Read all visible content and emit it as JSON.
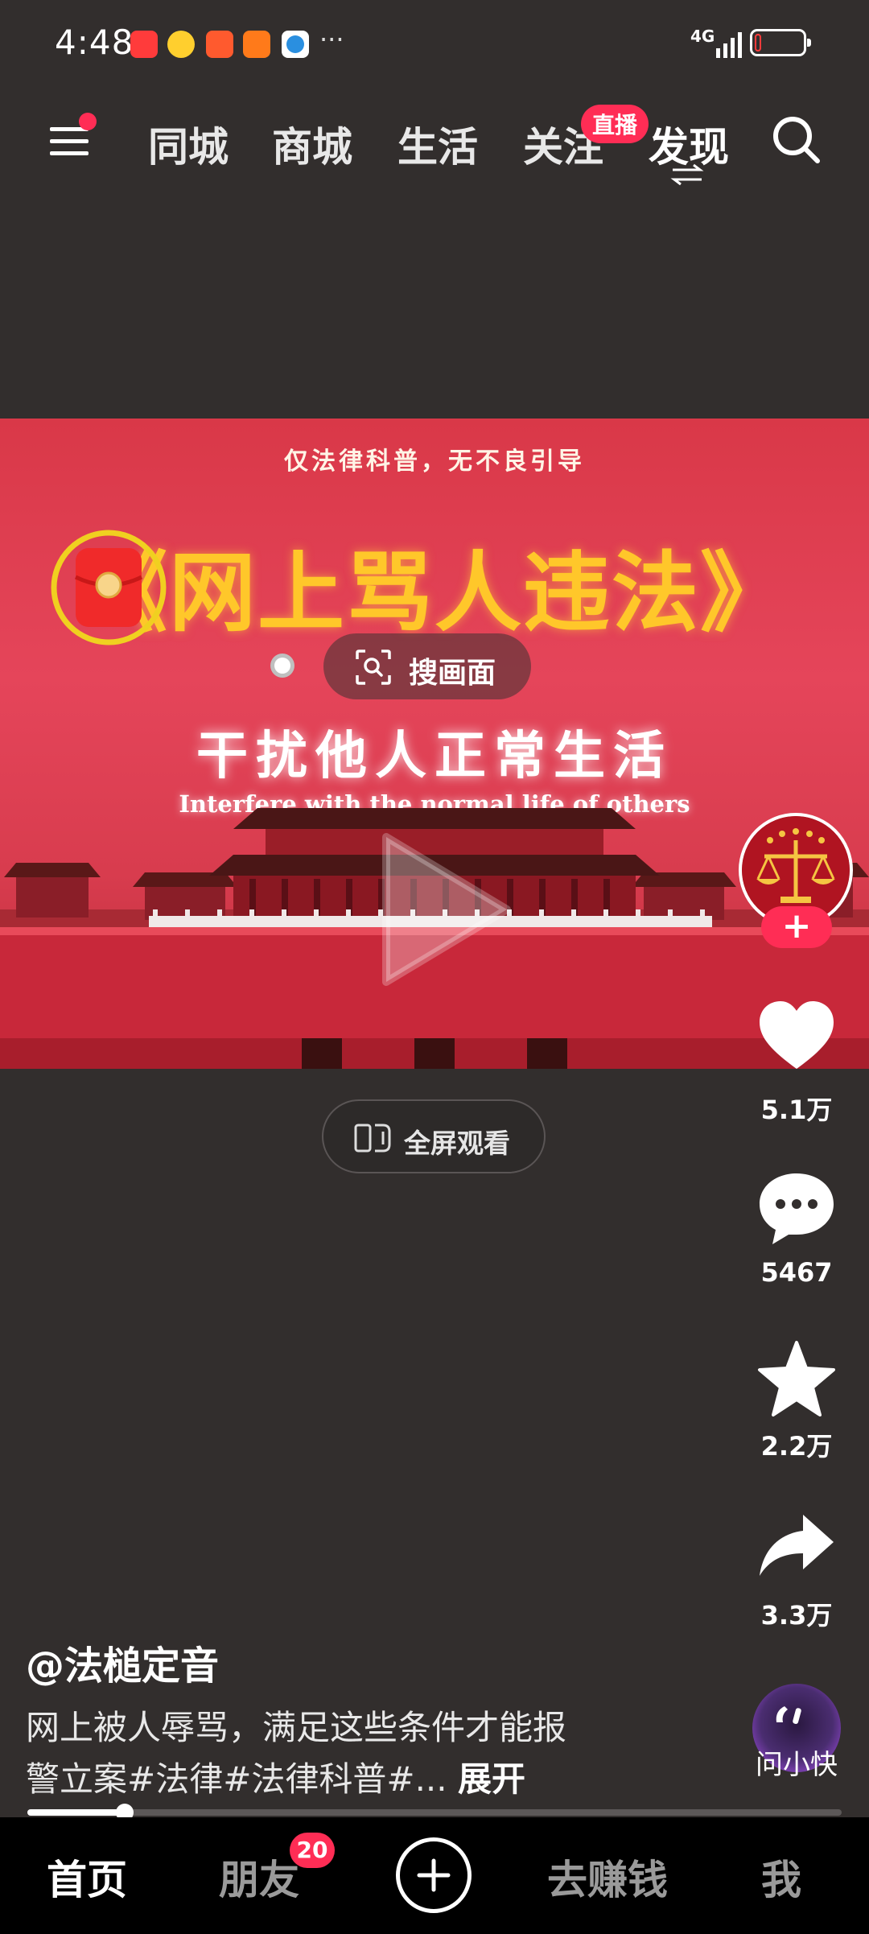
{
  "status_bar": {
    "time": "4:48",
    "network": "4G",
    "more": "···"
  },
  "top_nav": {
    "tabs": [
      "同城",
      "商城",
      "生活",
      "关注",
      "发现"
    ],
    "active_tab": "发现",
    "live_badge": "直播"
  },
  "video": {
    "disclaimer": "仅法律科普，无不良引导",
    "title": "《网上骂人违法》",
    "subtitle": "干扰他人正常生活",
    "english": "Interfere with the normal life of others",
    "search_frame_label": "搜画面",
    "fullscreen_label": "全屏观看",
    "progress": 0.12
  },
  "right_rail": {
    "likes": "5.1万",
    "comments": "5467",
    "favorites": "2.2万",
    "shares": "3.3万",
    "follow": "+"
  },
  "post": {
    "author": "@法槌定音",
    "caption_line1": "网上被人辱骂，满足这些条件才能报",
    "caption_line2": "警立案#法律#法律科普#...",
    "expand": "展开"
  },
  "assistant": {
    "label": "问小快"
  },
  "bottom_nav": {
    "home": "首页",
    "friends": "朋友",
    "friends_badge": "20",
    "earn": "去赚钱",
    "me": "我"
  },
  "colors": {
    "accent": "#ff2d55",
    "background": "#322e2d",
    "title_gold": "#ffc72a"
  }
}
